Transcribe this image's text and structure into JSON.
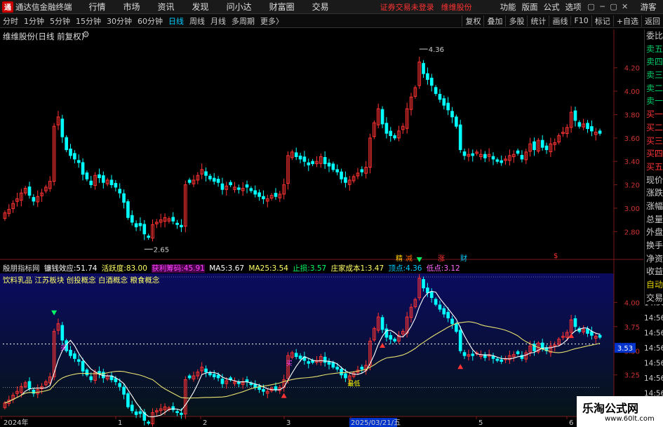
{
  "app": {
    "title": "通达信金融终端",
    "logo_char": "通"
  },
  "menu": [
    "行情",
    "市场",
    "资讯",
    "发现",
    "问小达",
    "财富圈",
    "交易"
  ],
  "notice": {
    "login": "证券交易未登录",
    "stock_name": "维维股份"
  },
  "menu_right": [
    "功能",
    "版面",
    "公式",
    "选项"
  ],
  "user": "游客",
  "window_controls": [
    "▢",
    "─",
    "▢",
    "✕"
  ],
  "toolbar": {
    "timeframes": [
      "分时",
      "1分钟",
      "5分钟",
      "15分钟",
      "30分钟",
      "60分钟",
      "日线",
      "周线",
      "月线",
      "多周期",
      "更多"
    ],
    "active": "日线",
    "more_arrow": "〉",
    "right": [
      "复权",
      "叠加",
      "多股",
      "统计",
      "画线",
      "F10",
      "标记",
      "+自选",
      "返回"
    ]
  },
  "main": {
    "title": "维维股份(日线 前复权)",
    "gear": "⚙",
    "arrow": "⌄"
  },
  "sidebar": [
    {
      "t": "委比",
      "c": "w"
    },
    {
      "t": "卖五",
      "c": "g"
    },
    {
      "t": "卖四",
      "c": "g"
    },
    {
      "t": "卖三",
      "c": "g"
    },
    {
      "t": "卖二",
      "c": "g"
    },
    {
      "t": "卖一",
      "c": "g"
    },
    {
      "t": "买一",
      "c": "r"
    },
    {
      "t": "买二",
      "c": "r"
    },
    {
      "t": "买三",
      "c": "r"
    },
    {
      "t": "买四",
      "c": "r"
    },
    {
      "t": "买五",
      "c": "r"
    },
    {
      "t": "现价",
      "c": "w"
    },
    {
      "t": "涨跌",
      "c": "w"
    },
    {
      "t": "涨幅",
      "c": "w"
    },
    {
      "t": "总量",
      "c": "w"
    },
    {
      "t": "外盘",
      "c": "w"
    },
    {
      "t": "换手",
      "c": "w"
    },
    {
      "t": "净资",
      "c": "w"
    },
    {
      "t": "收益",
      "c": "w"
    },
    {
      "t": "自动",
      "c": "y"
    },
    {
      "t": "交易",
      "c": "w"
    }
  ],
  "indicator": {
    "name": "殷朋指标网",
    "items": [
      {
        "label": "镰钱效应:",
        "value": "51.74",
        "color": "#ffffff"
      },
      {
        "label": "活跃度:",
        "value": "83.00",
        "color": "#ffff66"
      },
      {
        "label": "获利筹码:",
        "value": "45.91",
        "color": "#ff44ff"
      },
      {
        "label": "MA5:",
        "value": "3.67",
        "color": "#ffffff"
      },
      {
        "label": "MA25:",
        "value": "3.54",
        "color": "#ffff66"
      },
      {
        "label": "止损:",
        "value": "3.57",
        "color": "#00ff66"
      },
      {
        "label": "庄家成本1:",
        "value": "3.47",
        "color": "#ffff66"
      },
      {
        "label": "顶点:",
        "value": "4.36",
        "color": "#00ccff"
      },
      {
        "label": "低点:",
        "value": "3.12",
        "color": "#ff66ff"
      }
    ],
    "concepts": "饮料乳品 江苏板块 创投概念 白酒概念 粮食概念"
  },
  "event_tags": [
    {
      "t": "精",
      "color": "#ffcc00"
    },
    {
      "t": "减",
      "color": "#ff6600"
    },
    {
      "t": "涨",
      "color": "#ff3333"
    },
    {
      "t": "财",
      "color": "#00ccff"
    },
    {
      "t": "$",
      "color": "#ff3333"
    }
  ],
  "xaxis": {
    "labels": [
      "2024年",
      "1",
      "2",
      "3",
      "2025/03/21/五",
      "5",
      "6"
    ]
  },
  "time_labels": [
    "14:56",
    "14:56",
    "14:56",
    "14:56",
    "14:56",
    "14:56",
    "14:56",
    "14:56",
    "14:56"
  ],
  "watermark": {
    "title": "乐淘公式网",
    "url": "www.60lt.com"
  },
  "signals": {
    "buy": "买",
    "sell": "卖",
    "low": "最低"
  },
  "colors": {
    "up": "#ff3232",
    "down": "#00ffff",
    "ma5": "#ffffff",
    "ma25": "#e8e070",
    "panel_top": "#0b0b60",
    "panel_bottom": "#061418",
    "highlight": "#0033cc"
  },
  "chart_data": [
    {
      "type": "candlestick",
      "panel": "price",
      "yticks": [
        "4.20",
        "4.00",
        "3.80",
        "3.60",
        "3.40",
        "3.20",
        "3.00",
        "2.80"
      ],
      "ylim": [
        2.67,
        4.42
      ],
      "annotations": [
        {
          "label": "4.36",
          "value": 4.36,
          "index": 101
        },
        {
          "label": "2.65",
          "value": 2.65,
          "index": 34
        }
      ],
      "closes": [
        2.96,
        2.99,
        3.04,
        3.08,
        3.13,
        3.17,
        3.11,
        3.06,
        3.1,
        3.13,
        3.18,
        3.23,
        3.7,
        3.78,
        3.61,
        3.5,
        3.45,
        3.42,
        3.39,
        3.29,
        3.25,
        3.2,
        3.28,
        3.26,
        3.22,
        3.24,
        3.2,
        3.18,
        3.13,
        3.05,
        2.92,
        2.88,
        2.84,
        2.85,
        2.78,
        2.75,
        2.86,
        2.88,
        2.9,
        2.92,
        2.91,
        2.89,
        2.86,
        2.84,
        3.2,
        3.22,
        3.24,
        3.28,
        3.33,
        3.28,
        3.25,
        3.23,
        3.22,
        3.16,
        3.19,
        3.2,
        3.18,
        3.16,
        3.17,
        3.18,
        3.15,
        3.12,
        3.1,
        3.08,
        3.08,
        3.11,
        3.1,
        3.12,
        3.2,
        3.45,
        3.48,
        3.44,
        3.42,
        3.4,
        3.37,
        3.38,
        3.4,
        3.44,
        3.38,
        3.36,
        3.33,
        3.31,
        3.25,
        3.22,
        3.24,
        3.27,
        3.3,
        3.31,
        3.35,
        3.6,
        3.73,
        3.85,
        3.72,
        3.64,
        3.62,
        3.6,
        3.66,
        3.7,
        3.85,
        3.95,
        4.03,
        4.25,
        4.15,
        4.1,
        4.05,
        3.98,
        3.93,
        3.88,
        3.84,
        3.78,
        3.7,
        3.5,
        3.45,
        3.46,
        3.45,
        3.48,
        3.46,
        3.43,
        3.46,
        3.42,
        3.4,
        3.39,
        3.42,
        3.45,
        3.46,
        3.47,
        3.42,
        3.48,
        3.55,
        3.5,
        3.58,
        3.52,
        3.5,
        3.55,
        3.56,
        3.62,
        3.65,
        3.69,
        3.82,
        3.75,
        3.7,
        3.72,
        3.68,
        3.66,
        3.65,
        3.64
      ]
    },
    {
      "type": "candlestick_with_ma",
      "panel": "indicator",
      "yticks": [
        "4.00",
        "3.75",
        "3.50",
        "3.25",
        "3.00"
      ],
      "ylim": [
        2.82,
        4.3
      ],
      "current_value": "3.53",
      "series": [
        {
          "name": "MA5",
          "value": 3.67
        },
        {
          "name": "MA25",
          "value": 3.54
        }
      ],
      "levels": [
        {
          "name": "顶点",
          "value": 4.36
        },
        {
          "name": "止损",
          "value": 3.57
        },
        {
          "name": "低点",
          "value": 3.12
        }
      ]
    }
  ]
}
